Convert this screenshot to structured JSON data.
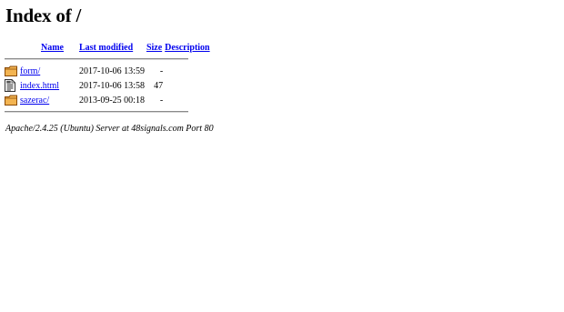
{
  "page": {
    "title": "Index of /"
  },
  "columns": {
    "name": "Name",
    "modified": "Last modified",
    "size": "Size",
    "description": "Description"
  },
  "entries": [
    {
      "icon": "folder-icon",
      "name": "form/",
      "modified": "2017-10-06 13:59",
      "size": "-",
      "description": ""
    },
    {
      "icon": "file-text-icon",
      "name": "index.html",
      "modified": "2017-10-06 13:58",
      "size": "47",
      "description": ""
    },
    {
      "icon": "folder-icon",
      "name": "sazerac/",
      "modified": "2013-09-25 00:18",
      "size": "-",
      "description": ""
    }
  ],
  "footer": {
    "address": "Apache/2.4.25 (Ubuntu) Server at 48signals.com Port 80"
  },
  "colors": {
    "link": "#0000ee",
    "folder": "#e8a23c",
    "rule": "#8a8a8a"
  }
}
